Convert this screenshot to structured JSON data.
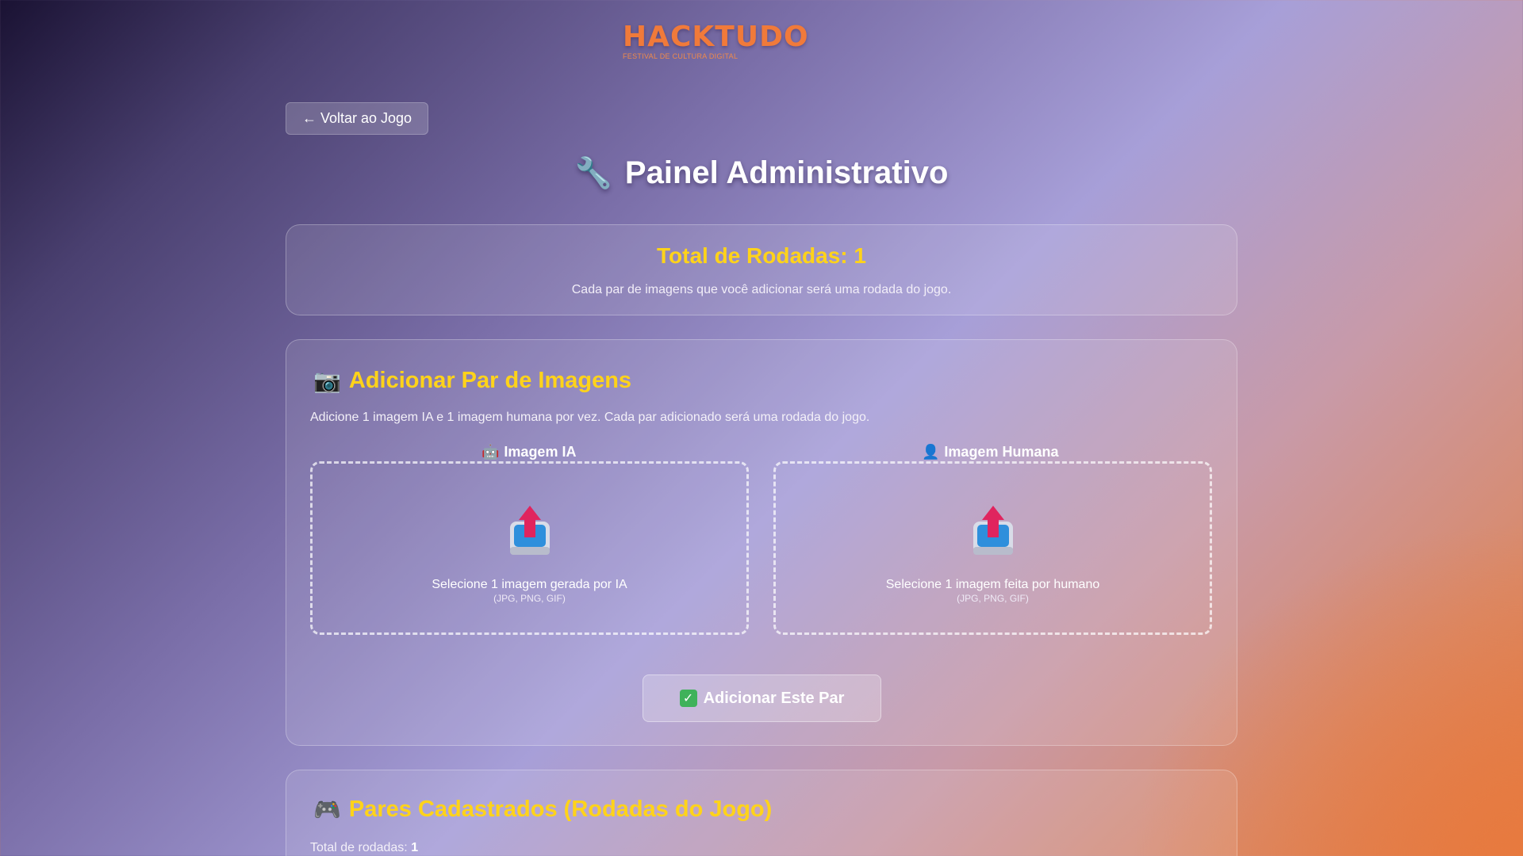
{
  "header": {
    "logo": "HACKTUDO",
    "tagline": "FESTIVAL DE CULTURA DIGITAL"
  },
  "nav": {
    "back_label": "← Voltar ao Jogo"
  },
  "page": {
    "title": "Painel Administrativo",
    "title_icon": "wrench-icon"
  },
  "stats": {
    "title_prefix": "Total de Rodadas: ",
    "total": "1",
    "description": "Cada par de imagens que você adicionar será uma rodada do jogo."
  },
  "add_pair": {
    "title": "Adicionar Par de Imagens",
    "title_icon": "camera-icon",
    "description": "Adicione 1 imagem IA e 1 imagem humana por vez. Cada par adicionado será uma rodada do jogo.",
    "ai": {
      "label": "Imagem IA",
      "icon": "robot-icon",
      "prompt": "Selecione 1 imagem gerada por IA",
      "formats": "(JPG, PNG, GIF)"
    },
    "human": {
      "label": "Imagem Humana",
      "icon": "person-icon",
      "prompt": "Selecione 1 imagem feita por humano",
      "formats": "(JPG, PNG, GIF)"
    },
    "submit_label": "Adicionar Este Par",
    "submit_icon": "check-icon"
  },
  "pairs": {
    "title": "Pares Cadastrados (Rodadas do Jogo)",
    "title_icon": "gamepad-icon",
    "count_label": "Total de rodadas: ",
    "count": "1"
  },
  "colors": {
    "accent": "#ffd31a",
    "brand": "#f07a3a"
  }
}
